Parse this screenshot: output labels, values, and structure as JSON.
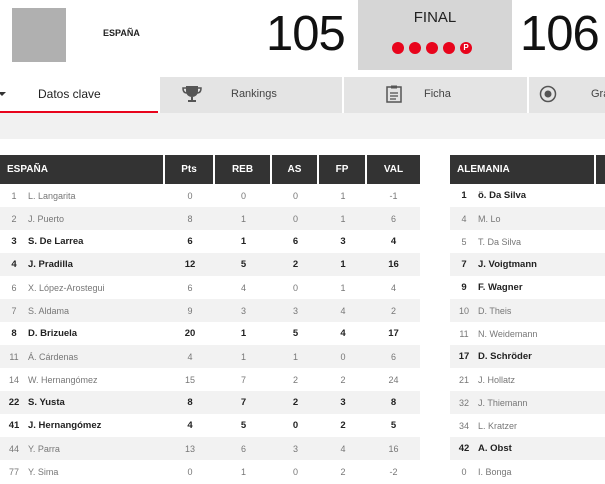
{
  "header": {
    "home_team": "ESPAÑA",
    "home_score": "105",
    "status": "FINAL",
    "periods": [
      "",
      "",
      "",
      ""
    ],
    "overtime_label": "P",
    "away_score": "106"
  },
  "tabs": [
    {
      "label": "Datos clave",
      "icon": "chevron-down-icon"
    },
    {
      "label": "Rankings",
      "icon": "trophy-icon"
    },
    {
      "label": "Ficha",
      "icon": "clipboard-icon"
    },
    {
      "label": "Grá",
      "icon": "circle-target-icon"
    }
  ],
  "home": {
    "headers": [
      "ESPAÑA",
      "Pts",
      "REB",
      "AS",
      "FP",
      "VAL"
    ],
    "rows": [
      {
        "num": "1",
        "name": "L. Langarita",
        "pts": "0",
        "reb": "0",
        "as": "0",
        "fp": "1",
        "val": "-1",
        "on": false
      },
      {
        "num": "2",
        "name": "J. Puerto",
        "pts": "8",
        "reb": "1",
        "as": "0",
        "fp": "1",
        "val": "6",
        "on": false
      },
      {
        "num": "3",
        "name": "S. De Larrea",
        "pts": "6",
        "reb": "1",
        "as": "6",
        "fp": "3",
        "val": "4",
        "on": true
      },
      {
        "num": "4",
        "name": "J. Pradilla",
        "pts": "12",
        "reb": "5",
        "as": "2",
        "fp": "1",
        "val": "16",
        "on": true
      },
      {
        "num": "6",
        "name": "X. López-Arostegui",
        "pts": "6",
        "reb": "4",
        "as": "0",
        "fp": "1",
        "val": "4",
        "on": false
      },
      {
        "num": "7",
        "name": "S. Aldama",
        "pts": "9",
        "reb": "3",
        "as": "3",
        "fp": "4",
        "val": "2",
        "on": false
      },
      {
        "num": "8",
        "name": "D. Brizuela",
        "pts": "20",
        "reb": "1",
        "as": "5",
        "fp": "4",
        "val": "17",
        "on": true
      },
      {
        "num": "11",
        "name": "Á. Cárdenas",
        "pts": "4",
        "reb": "1",
        "as": "1",
        "fp": "0",
        "val": "6",
        "on": false
      },
      {
        "num": "14",
        "name": "W. Hernangómez",
        "pts": "15",
        "reb": "7",
        "as": "2",
        "fp": "2",
        "val": "24",
        "on": false
      },
      {
        "num": "22",
        "name": "S. Yusta",
        "pts": "8",
        "reb": "7",
        "as": "2",
        "fp": "3",
        "val": "8",
        "on": true
      },
      {
        "num": "41",
        "name": "J. Hernangómez",
        "pts": "4",
        "reb": "5",
        "as": "0",
        "fp": "2",
        "val": "5",
        "on": true
      },
      {
        "num": "44",
        "name": "Y. Parra",
        "pts": "13",
        "reb": "6",
        "as": "3",
        "fp": "4",
        "val": "16",
        "on": false
      },
      {
        "num": "77",
        "name": "Y. Sima",
        "pts": "0",
        "reb": "1",
        "as": "0",
        "fp": "2",
        "val": "-2",
        "on": false
      }
    ]
  },
  "away": {
    "headers": [
      "ALEMANIA"
    ],
    "rows": [
      {
        "num": "1",
        "name": "ö. Da Silva",
        "on": true
      },
      {
        "num": "4",
        "name": "M. Lo",
        "on": false
      },
      {
        "num": "5",
        "name": "T. Da Silva",
        "on": false
      },
      {
        "num": "7",
        "name": "J. Voigtmann",
        "on": true
      },
      {
        "num": "9",
        "name": "F. Wagner",
        "on": true
      },
      {
        "num": "10",
        "name": "D. Theis",
        "on": false
      },
      {
        "num": "11",
        "name": "N. Weidemann",
        "on": false
      },
      {
        "num": "17",
        "name": "D. Schröder",
        "on": true
      },
      {
        "num": "21",
        "name": "J. Hollatz",
        "on": false
      },
      {
        "num": "32",
        "name": "J. Thiemann",
        "on": false
      },
      {
        "num": "34",
        "name": "L. Kratzer",
        "on": false
      },
      {
        "num": "42",
        "name": "A. Obst",
        "on": true
      },
      {
        "num": "0",
        "name": "I. Bonga",
        "on": false
      }
    ]
  }
}
